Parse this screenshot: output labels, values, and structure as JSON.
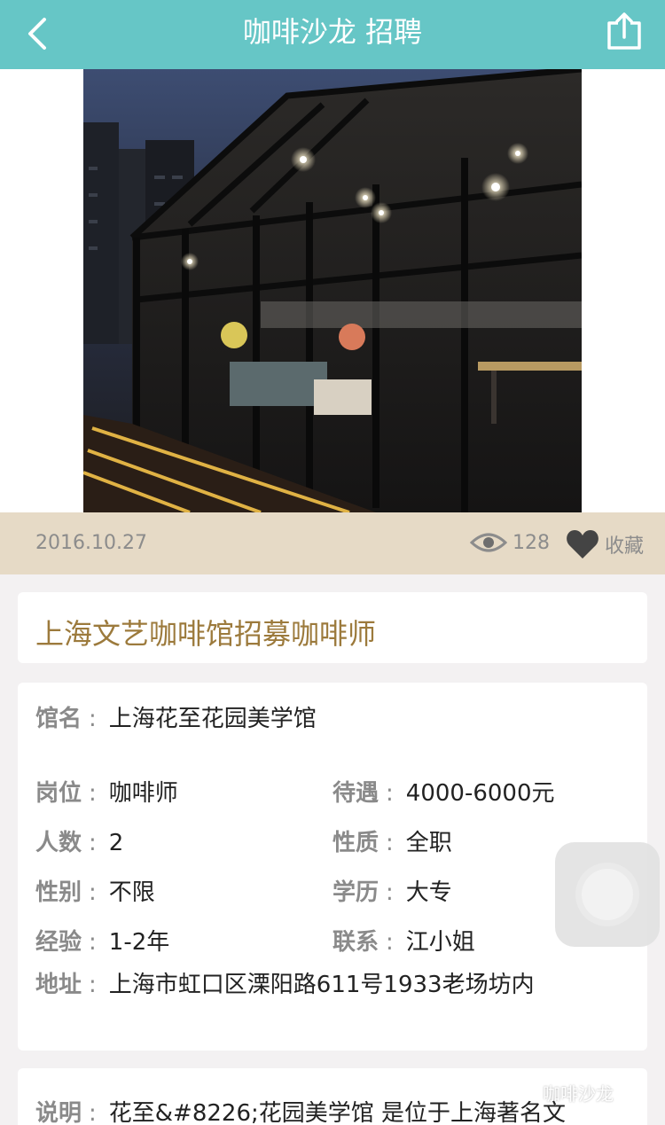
{
  "nav": {
    "title": "咖啡沙龙 招聘",
    "back_icon": "chevron-left-icon",
    "share_icon": "share-icon"
  },
  "hero": {
    "image": "glass-greenhouse-cafe-at-night"
  },
  "meta": {
    "date": "2016.10.27",
    "views": "128",
    "favorite_label": "收藏"
  },
  "post": {
    "title": "上海文艺咖啡馆招募咖啡师"
  },
  "info": {
    "venue": {
      "label": "馆名",
      "value": "上海花至花园美学馆"
    },
    "position": {
      "label": "岗位",
      "value": "咖啡师"
    },
    "salary": {
      "label": "待遇",
      "value": "4000-6000元"
    },
    "headcount": {
      "label": "人数",
      "value": "2"
    },
    "type": {
      "label": "性质",
      "value": "全职"
    },
    "gender": {
      "label": "性别",
      "value": "不限"
    },
    "education": {
      "label": "学历",
      "value": "大专"
    },
    "experience": {
      "label": "经验",
      "value": "1-2年"
    },
    "contact": {
      "label": "联系",
      "value": "江小姐"
    },
    "address": {
      "label": "地址",
      "value": "上海市虹口区溧阳路611号1933老场坊内"
    }
  },
  "description": {
    "label": "说明",
    "value": "花至&#8226;花园美学馆 是位于上海著名文"
  },
  "watermark": {
    "text": "咖啡沙龙"
  },
  "colors": {
    "nav_bg": "#66c6c6",
    "meta_bg": "#e6dac6",
    "title_color": "#9c7a3c"
  }
}
